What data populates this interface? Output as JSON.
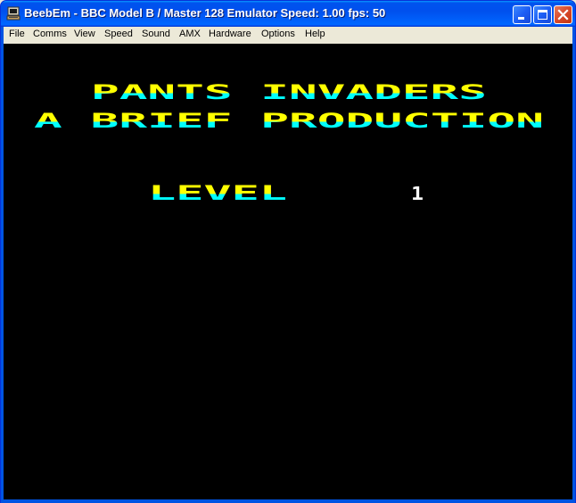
{
  "window": {
    "title": "BeebEm - BBC Model B / Master 128 Emulator  Speed: 1.00  fps: 50"
  },
  "menu": {
    "items": [
      "File",
      "Comms",
      "View",
      "Speed",
      "Sound",
      "AMX",
      "Hardware",
      "Options",
      "Help"
    ]
  },
  "game": {
    "line1": "PANTS INVADERS",
    "line2": "A BRIEF PRODUCTION",
    "level_label": "LEVEL",
    "level_value": "1"
  },
  "colors": {
    "titlebar": "#0054e3",
    "screen_bg": "#000000",
    "text_top": "#ffff00",
    "text_bottom": "#00ffff",
    "level_digit": "#ffffff"
  }
}
